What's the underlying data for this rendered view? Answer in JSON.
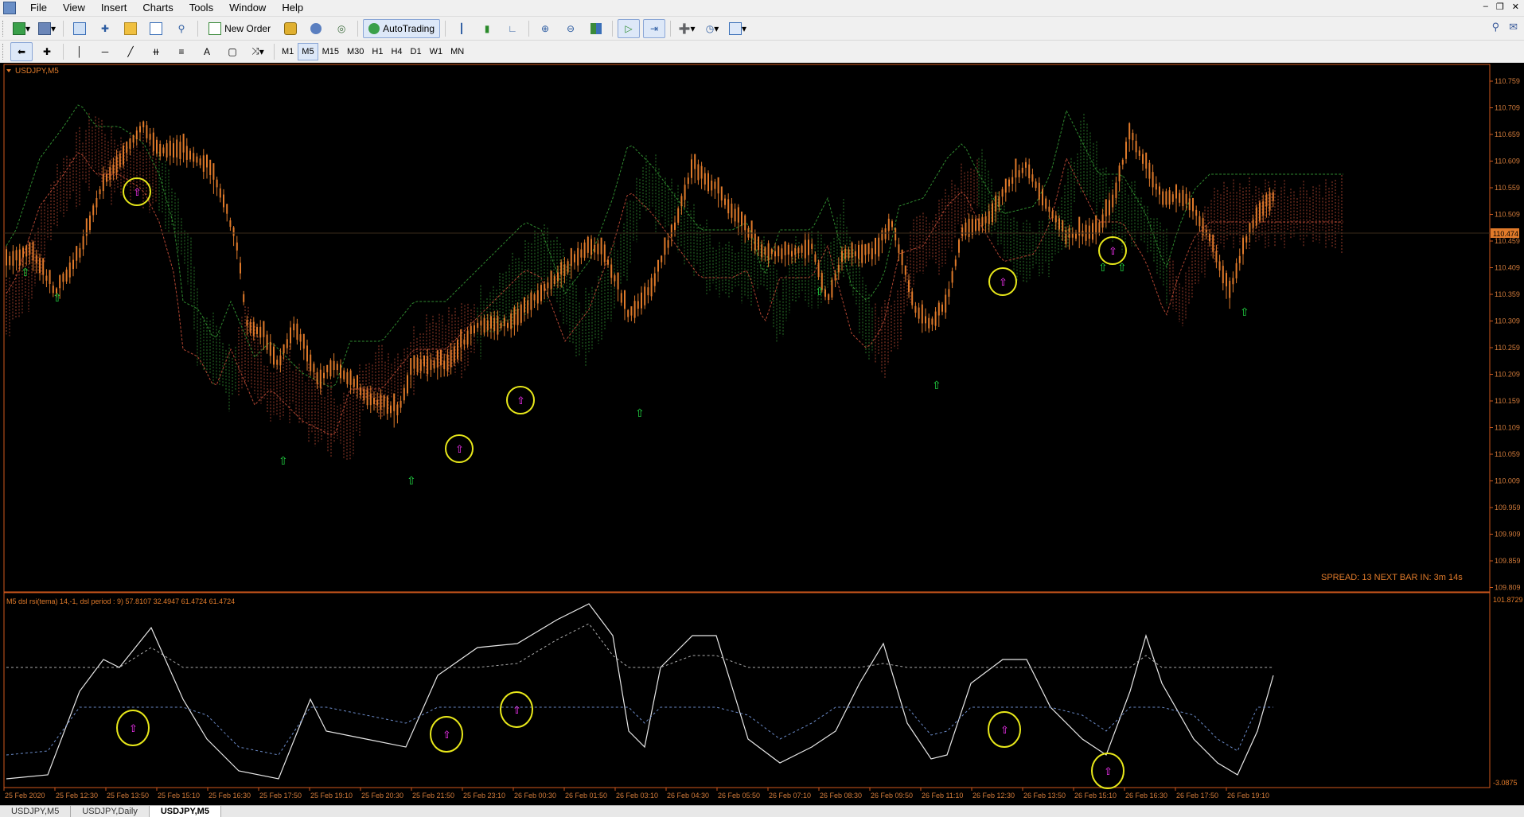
{
  "menu": [
    "File",
    "View",
    "Insert",
    "Charts",
    "Tools",
    "Window",
    "Help"
  ],
  "toolbar": {
    "new_order": "New Order",
    "autotrading": "AutoTrading"
  },
  "timeframes": [
    "M1",
    "M5",
    "M15",
    "M30",
    "H1",
    "H4",
    "D1",
    "W1",
    "MN"
  ],
  "active_timeframe": "M5",
  "main_chart": {
    "symbol_label": "USDJPY,M5",
    "current_price": "110.474",
    "info_text": "SPREAD: 13  NEXT BAR IN: 3m 14s",
    "y_ticks": [
      "110.759",
      "110.709",
      "110.659",
      "110.609",
      "110.559",
      "110.509",
      "110.459",
      "110.409",
      "110.359",
      "110.309",
      "110.259",
      "110.209",
      "110.159",
      "110.109",
      "110.059",
      "110.009",
      "109.959",
      "109.909",
      "109.859",
      "109.809"
    ],
    "colors": {
      "candle": "#e07a2a",
      "cloud_bear": "#b24632",
      "cloud_bull": "#2f8a2f",
      "circle": "#e8e81a",
      "arrow_up_green": "#22dd44",
      "arrow_magenta": "#ff33ff",
      "frame": "#d0581c"
    }
  },
  "indicator": {
    "label": "M5 dsl rsi(tema) 14,-1, dsl period : 9) 57.8107 32.4947 61.4724 61.4724",
    "y_top": "101.8729",
    "y_bottom": "-3.0875"
  },
  "x_ticks": [
    "25 Feb 2020",
    "25 Feb 12:30",
    "25 Feb 13:50",
    "25 Feb 15:10",
    "25 Feb 16:30",
    "25 Feb 17:50",
    "25 Feb 19:10",
    "25 Feb 20:30",
    "25 Feb 21:50",
    "25 Feb 23:10",
    "26 Feb 00:30",
    "26 Feb 01:50",
    "26 Feb 03:10",
    "26 Feb 04:30",
    "26 Feb 05:50",
    "26 Feb 07:10",
    "26 Feb 08:30",
    "26 Feb 09:50",
    "26 Feb 11:10",
    "26 Feb 12:30",
    "26 Feb 13:50",
    "26 Feb 15:10",
    "26 Feb 16:30",
    "26 Feb 17:50",
    "26 Feb 19:10"
  ],
  "tabs": [
    {
      "label": "USDJPY,M5",
      "active": false
    },
    {
      "label": "USDJPY,Daily",
      "active": false
    },
    {
      "label": "USDJPY,M5",
      "active": true
    }
  ]
}
